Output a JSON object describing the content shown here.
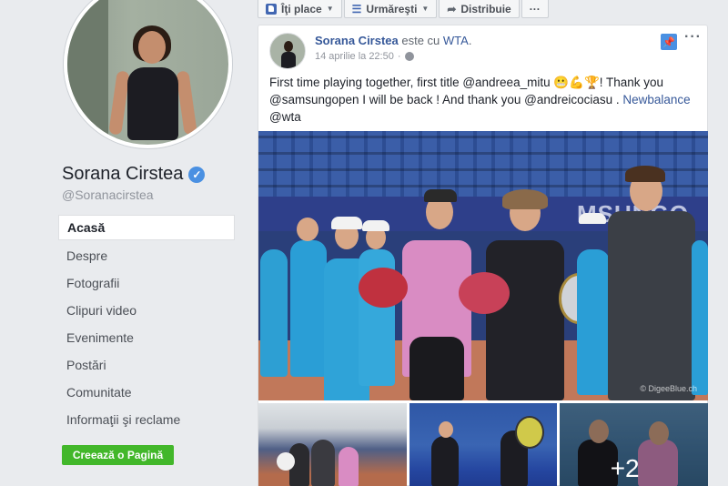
{
  "page": {
    "name": "Sorana Cirstea",
    "username": "@Soranacirstea",
    "verified_mark": "✓"
  },
  "nav": {
    "items": [
      {
        "label": "Acasă",
        "active": true
      },
      {
        "label": "Despre"
      },
      {
        "label": "Fotografii"
      },
      {
        "label": "Clipuri video"
      },
      {
        "label": "Evenimente"
      },
      {
        "label": "Postări"
      },
      {
        "label": "Comunitate"
      },
      {
        "label": "Informaţii şi reclame"
      }
    ],
    "create_page_label": "Creează o Pagină"
  },
  "action_bar": {
    "like_label": "Îţi place",
    "follow_label": "Urmăreşti",
    "share_label": "Distribuie",
    "more_label": "···"
  },
  "post": {
    "author": "Sorana Cirstea",
    "with_text": " este cu ",
    "with_tag": "WTA",
    "with_end": ".",
    "time": "14 aprilie la 22:50",
    "time_sep": "·",
    "pin_icon": "📌",
    "more_icon": "···",
    "text_part1": "First time playing together, first title @andreea_mitu 😬💪🏆! Thank you @samsungopen I will be back ! And thank you @andreicociasu . ",
    "text_link": "Newbalance",
    "text_part2": " @wta",
    "photo_banner": "MSUNGO",
    "photo_watermark": "© DigeeBlue.ch",
    "more_photos": "+2"
  },
  "colors": {
    "accent": "#4267b2",
    "link": "#365899",
    "create_button": "#42b72a",
    "verified": "#4a90e2"
  }
}
